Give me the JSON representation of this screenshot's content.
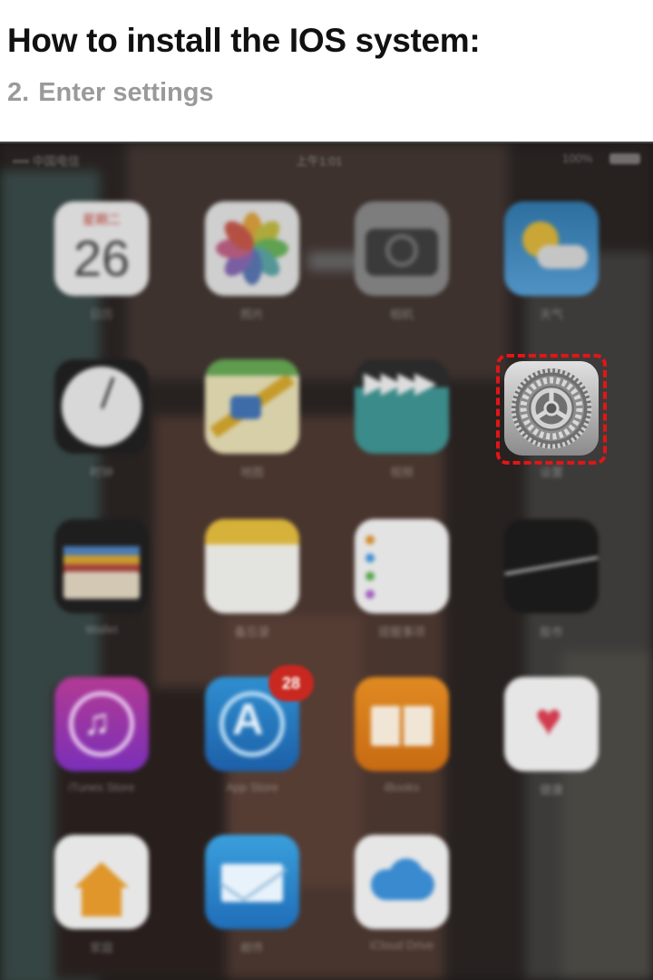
{
  "header": {
    "title": "How to install the IOS system:",
    "step_number": "2.",
    "step_text": "Enter settings"
  },
  "statusbar": {
    "carrier": "•••• 中国电信",
    "time": "上午1:01",
    "battery": "100%"
  },
  "calendar": {
    "weekday": "星期二",
    "day": "26"
  },
  "badges": {
    "app_store": "28"
  },
  "home_apps": [
    "日历",
    "照片",
    "相机",
    "天气",
    "时钟",
    "地图",
    "视频",
    "设置",
    "Wallet",
    "备忘录",
    "提醒事项",
    "股市",
    "iTunes Store",
    "App Store",
    "iBooks",
    "健康",
    "家庭",
    "邮件",
    "iCloud Drive"
  ],
  "highlight": {
    "target": "settings",
    "color": "#e01616"
  }
}
